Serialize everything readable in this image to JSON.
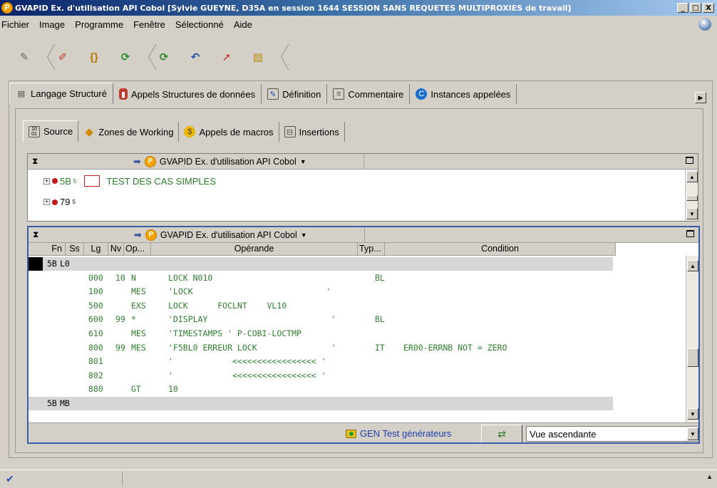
{
  "window": {
    "title": "GVAPID Ex. d'utilisation API Cobol [Sylvie GUEYNE, D35A en session 1644 SESSION SANS REQUETES MULTIPROXIES de travail]",
    "app_badge": "P",
    "minimize": "_",
    "maximize": "□",
    "close": "X"
  },
  "menu": [
    "Fichier",
    "Image",
    "Programme",
    "Fenêtre",
    "Sélectionné",
    "Aide"
  ],
  "toolbar": {
    "icons": [
      "tag-icon",
      "brush-icon",
      "braces-icon",
      "refresh-icon",
      "refresh-icon",
      "undo-icon",
      "pin-icon",
      "document-icon"
    ]
  },
  "main_tabs": [
    {
      "label": "Langage Structuré",
      "icon": "printer-icon",
      "active": true
    },
    {
      "label": "Appels Structures de données",
      "icon": "database-icon"
    },
    {
      "label": "Définition",
      "icon": "edit-icon"
    },
    {
      "label": "Commentaire",
      "icon": "comment-icon"
    },
    {
      "label": "Instances appelées",
      "icon": "c-icon"
    }
  ],
  "sub_tabs": [
    {
      "label": "Source",
      "icon": "binary-icon",
      "active": true
    },
    {
      "label": "Zones de Working",
      "icon": "diamond-icon"
    },
    {
      "label": "Appels de macros",
      "icon": "dollar-icon"
    },
    {
      "label": "Insertions",
      "icon": "insert-icon"
    }
  ],
  "top_viewer": {
    "title": "GVAPID Ex. d'utilisation API Cobol",
    "badge": "P",
    "rows": [
      {
        "code": "5B",
        "level": "5",
        "label": "TEST DES CAS SIMPLES"
      },
      {
        "code": "79",
        "level": "5",
        "label": ""
      }
    ]
  },
  "bottom_viewer": {
    "title": "GVAPID Ex. d'utilisation API Cobol",
    "badge": "P",
    "columns": [
      "Fn",
      "Ss",
      "Lg",
      "Nv",
      "Op...",
      "Opérande",
      "Typ...",
      "Condition"
    ],
    "rows": [
      {
        "fn": "5B",
        "ss": "L0",
        "lg": "",
        "nv": "",
        "op": "",
        "operand": "",
        "typ": "",
        "cond": "",
        "grey": true
      },
      {
        "fn": "",
        "ss": "",
        "lg": "000",
        "nv": "10",
        "op": "N",
        "operand": "LOCK N010",
        "typ": "BL",
        "cond": ""
      },
      {
        "fn": "",
        "ss": "",
        "lg": "100",
        "nv": "",
        "op": "MES",
        "operand": "'LOCK                           '",
        "typ": "",
        "cond": ""
      },
      {
        "fn": "",
        "ss": "",
        "lg": "500",
        "nv": "",
        "op": "EXS",
        "operand": "LOCK      FOCLNT    VL10",
        "typ": "",
        "cond": ""
      },
      {
        "fn": "",
        "ss": "",
        "lg": "600",
        "nv": "99",
        "op": "*",
        "operand": "'DISPLAY                         '",
        "typ": "BL",
        "cond": ""
      },
      {
        "fn": "",
        "ss": "",
        "lg": "610",
        "nv": "",
        "op": "MES",
        "operand": "'TIMESTAMPS ' P-COBI-LOCTMP",
        "typ": "",
        "cond": ""
      },
      {
        "fn": "",
        "ss": "",
        "lg": "800",
        "nv": "99",
        "op": "MES",
        "operand": "'F5BL0 ERREUR LOCK               '",
        "typ": "IT",
        "cond": "ER00-ERRNB NOT = ZERO"
      },
      {
        "fn": "",
        "ss": "",
        "lg": "801",
        "nv": "",
        "op": "",
        "operand": "'            <<<<<<<<<<<<<<<<< '",
        "typ": "",
        "cond": ""
      },
      {
        "fn": "",
        "ss": "",
        "lg": "802",
        "nv": "",
        "op": "",
        "operand": "'            <<<<<<<<<<<<<<<<< '",
        "typ": "",
        "cond": ""
      },
      {
        "fn": "",
        "ss": "",
        "lg": "880",
        "nv": "",
        "op": "GT",
        "operand": "10",
        "typ": "",
        "cond": ""
      },
      {
        "fn": "5B",
        "ss": "MB",
        "lg": "",
        "nv": "",
        "op": "",
        "operand": "",
        "typ": "",
        "cond": "",
        "grey": true
      }
    ]
  },
  "footer": {
    "gen_link": "GEN Test générateurs",
    "view_select": "Vue ascendante"
  }
}
